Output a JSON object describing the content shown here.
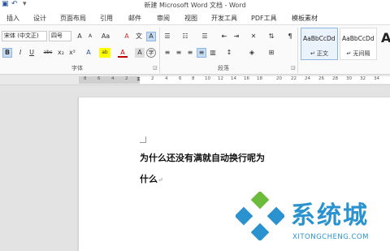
{
  "window": {
    "title": "新建 Microsoft Word 文档 - Word"
  },
  "quick_access": [
    "save-icon",
    "undo-icon",
    "customize-icon"
  ],
  "tabs": [
    {
      "label": "插入"
    },
    {
      "label": "设计"
    },
    {
      "label": "页面布局"
    },
    {
      "label": "引用"
    },
    {
      "label": "邮件"
    },
    {
      "label": "审阅"
    },
    {
      "label": "视图"
    },
    {
      "label": "开发工具"
    },
    {
      "label": "PDF工具"
    },
    {
      "label": "模板素材"
    }
  ],
  "font": {
    "name": "宋体 (中文正)",
    "size": "四号",
    "grow": "A",
    "shrink": "A",
    "case": "Aa",
    "clear_format": "A",
    "pinyin": "文",
    "border_char": "A",
    "bold": "B",
    "italic": "I",
    "underline": "U",
    "strike": "abc",
    "subscript": "x₂",
    "superscript": "x²",
    "effects": "A",
    "highlight": "ab",
    "color": "A",
    "shading": "A",
    "enclose": "字",
    "group_label": "字体"
  },
  "paragraph": {
    "group_label": "段落"
  },
  "styles": [
    {
      "preview": "AaBbCcDd",
      "name": "↵ 正文"
    },
    {
      "preview": "AaBbCcDd",
      "name": "↵ 无间隔"
    }
  ],
  "style_big": "A",
  "ruler": {
    "left_numbers": [
      "8",
      "6",
      "4",
      "2"
    ],
    "right_numbers": [
      "2",
      "4",
      "6",
      "8",
      "10",
      "12",
      "14",
      "16",
      "18",
      "20",
      "22",
      "24",
      "26",
      "28",
      "30",
      "32",
      "34"
    ]
  },
  "document": {
    "line1": "为什么还没有满就自动换行呢为",
    "line2": "什么",
    "para_mark": "↵"
  },
  "watermark": {
    "brand": "系统城",
    "url": "XITONGCHENG.COM"
  },
  "colors": {
    "accent": "#2b579a",
    "watermark_blue": "#2a93cf",
    "watermark_green": "#6dbb3a"
  }
}
